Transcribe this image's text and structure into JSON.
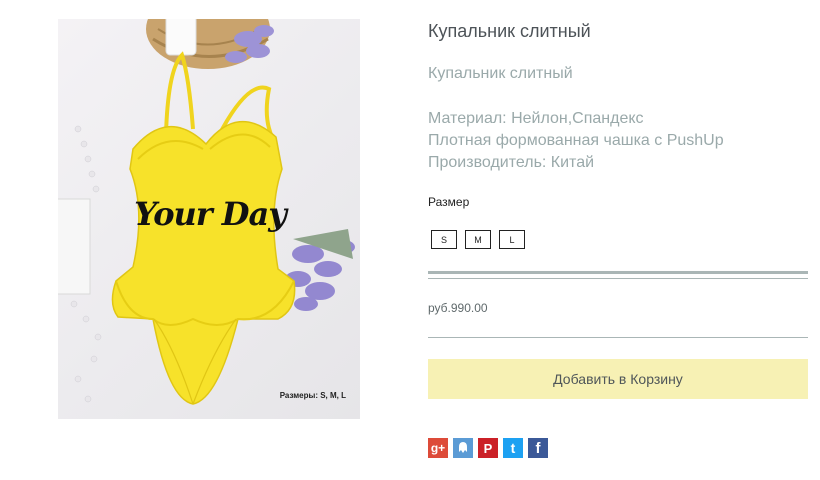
{
  "product": {
    "title": "Купальник слитный",
    "subtitle": "Купальник слитный",
    "description": [
      "Материал: Нейлон,Спандекс",
      "Плотная формованная чашка с PushUp",
      "Производитель: Китай"
    ],
    "image": {
      "brand_text": "Your Day",
      "caption": "Размеры: S, M, L"
    }
  },
  "size_selector": {
    "label": "Размер",
    "options": [
      "S",
      "M",
      "L"
    ]
  },
  "price": "руб.990.00",
  "cart": {
    "add_label": "Добавить в Корзину"
  },
  "share": {
    "icons": [
      {
        "name": "google-plus-icon",
        "glyph": "g+",
        "color": "#dd4b39"
      },
      {
        "name": "vk-icon",
        "glyph": "",
        "color": "#5b9bd5"
      },
      {
        "name": "pinterest-icon",
        "glyph": "P",
        "color": "#cb2027"
      },
      {
        "name": "twitter-icon",
        "glyph": "t",
        "color": "#1da1f2"
      },
      {
        "name": "facebook-icon",
        "glyph": "f",
        "color": "#3b5998"
      }
    ]
  },
  "colors": {
    "swimsuit": "#f7e22a",
    "button_bg": "#f7f1b4",
    "divider": "#aab6b6",
    "muted_text": "#9aa9aa"
  }
}
